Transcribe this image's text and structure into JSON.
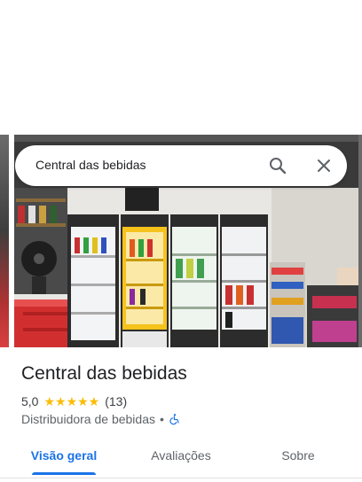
{
  "search": {
    "query": "Central das bebidas"
  },
  "place": {
    "name": "Central das bebidas",
    "rating": "5,0",
    "stars": "★★★★★",
    "review_count": "(13)",
    "category": "Distribuidora de bebidas",
    "separator": "•"
  },
  "tabs": [
    {
      "label": "Visão geral"
    },
    {
      "label": "Avaliações"
    },
    {
      "label": "Sobre"
    }
  ],
  "colors": {
    "accent": "#1a73e8",
    "star": "#fbbc04",
    "text": "#202124",
    "muted": "#5f6368"
  },
  "icons": {
    "search": "search-icon",
    "close": "close-icon",
    "accessibility": "wheelchair-icon"
  }
}
